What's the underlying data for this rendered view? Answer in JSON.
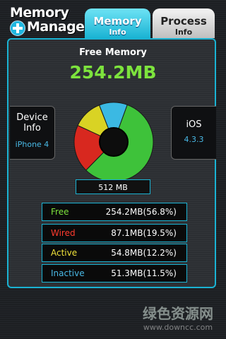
{
  "logo": {
    "line1": "Memory",
    "line2": "Manager"
  },
  "tabs": {
    "memory": {
      "label": "Memory",
      "sub": "Info"
    },
    "process": {
      "label": "Process",
      "sub": "Info"
    }
  },
  "summary": {
    "title": "Free Memory",
    "value": "254.2MB"
  },
  "device": {
    "label_line1": "Device",
    "label_line2": "Info",
    "value": "iPhone 4"
  },
  "os": {
    "label": "iOS",
    "value": "4.3.3"
  },
  "total": "512 MB",
  "chart_data": {
    "type": "pie",
    "donut": true,
    "categories": [
      "Free",
      "Wired",
      "Active",
      "Inactive"
    ],
    "values": [
      56.8,
      19.5,
      12.2,
      11.5
    ],
    "colors": [
      "#3ec23a",
      "#d8281f",
      "#d9d324",
      "#3bb9e3"
    ]
  },
  "stats": [
    {
      "label": "Free",
      "value": "254.2MB(56.8%)",
      "color": "#7de33d"
    },
    {
      "label": "Wired",
      "value": "87.1MB(19.5%)",
      "color": "#ff3b2e"
    },
    {
      "label": "Active",
      "value": "54.8MB(12.2%)",
      "color": "#f0e23a"
    },
    {
      "label": "Inactive",
      "value": "51.3MB(11.5%)",
      "color": "#49b9e6"
    }
  ],
  "watermark": {
    "line1": "绿色资源网",
    "line2": "www.downcc.com"
  }
}
